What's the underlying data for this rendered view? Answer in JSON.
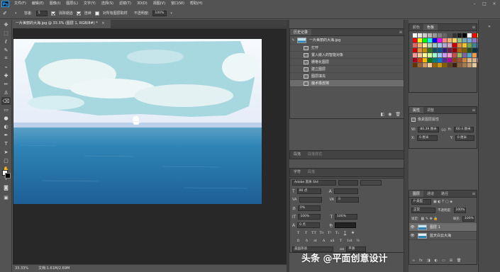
{
  "app": {
    "logo": "Ps"
  },
  "menu": [
    "文件(F)",
    "编辑(E)",
    "图像(I)",
    "图层(L)",
    "文字(Y)",
    "选择(S)",
    "滤镜(T)",
    "3D(D)",
    "视图(V)",
    "窗口(W)",
    "帮助(H)"
  ],
  "options": {
    "size_label": "容差:",
    "size_value": "5",
    "antialias": "消除锯齿",
    "contiguous": "连续",
    "all_layers": "对所有图层取样",
    "opacity_label": "不透明度:",
    "opacity_value": "100%"
  },
  "document": {
    "tab_title": "一片美丽的大海.jpg @ 33.3% (图层 1, RGB/8#) *",
    "close": "×",
    "zoom": "33.33%",
    "docsize": "文档:1.61M/2.69M"
  },
  "history": {
    "tab": "历史记录",
    "snapshot": "一片美丽的大海.jpg",
    "items": [
      "打开",
      "置入嵌入的智能对象",
      "栅格化图层",
      "建立图层",
      "图层填充",
      "魔术橡皮擦"
    ],
    "selected_index": 5
  },
  "swatches": {
    "tab_inactive": "颜色",
    "tab_active": "色板"
  },
  "properties": {
    "tabs": [
      "属性",
      "调整"
    ],
    "title": "像素图层属性",
    "w_label": "W:",
    "w_value": "80.39 厘米",
    "link": "GO",
    "h_label": "H:",
    "h_value": "60.4 厘米",
    "x_label": "X:",
    "x_value": "0 厘米",
    "y_label": "Y:",
    "y_value": "0 厘米"
  },
  "mini_panels": [
    {
      "label": "段落",
      "tab": "段落样式"
    },
    {
      "label": "字符",
      "tab": "段落"
    }
  ],
  "character": {
    "font": "Adobe 黑体 Std",
    "size": "90 点",
    "tracking": "0",
    "scale_v": "100%",
    "scale_h": "100%",
    "baseline": "0 点",
    "percent": "0%",
    "lang": "美国英语",
    "aa": "平滑"
  },
  "layers": {
    "tabs": [
      "图层",
      "通道",
      "路径"
    ],
    "kind": "P 类型",
    "blend": "正常",
    "opacity_label": "不透明度:",
    "opacity_value": "100%",
    "fill_label": "填充:",
    "fill_value": "100%",
    "lock_label": "锁定:",
    "items": [
      "图层 1",
      "蓝天白云大海"
    ]
  },
  "watermark": "头条 @平面创意设计",
  "colors": {
    "panel": "#535353",
    "canvas": "#282828",
    "sky": "#9fd3dc",
    "sea": "#2c79a8",
    "selection": "#6d6d6d"
  },
  "swatch_colors": [
    "#ffffff",
    "#e6e6e6",
    "#cccccc",
    "#b3b3b3",
    "#999999",
    "#808080",
    "#666666",
    "#4d4d4d",
    "#333333",
    "#1a1a1a",
    "#000000",
    "#ffffff",
    "#ff0000",
    "#ffff00",
    "#ff0000",
    "#ffff00",
    "#00ff00",
    "#00ffff",
    "#0000ff",
    "#ff00ff",
    "#f28b82",
    "#f6b26b",
    "#ffd966",
    "#93c47d",
    "#76a5af",
    "#6fa8dc",
    "#8e7cc3",
    "#c27ba0",
    "#e06666",
    "#f6b26b",
    "#ffe599",
    "#b6d7a8",
    "#a2c4c9",
    "#9fc5e8",
    "#b4a7d6",
    "#d5a6bd",
    "#cc0000",
    "#e69138",
    "#f1c232",
    "#6aa84f",
    "#45818e",
    "#3d85c6",
    "#cc0000",
    "#e69138",
    "#bf9000",
    "#38761d",
    "#134f5c",
    "#0b5394",
    "#351c75",
    "#741b47",
    "#990000",
    "#b45f06",
    "#7f6000",
    "#274e13",
    "#0c343d",
    "#073763",
    "#ff9999",
    "#ffcc99",
    "#ffff99",
    "#ccff99",
    "#99ffcc",
    "#99ccff",
    "#cc99ff",
    "#ff99cc",
    "#c0504d",
    "#9bbb59",
    "#8064a2",
    "#4bacc6",
    "#f79646",
    "#1f497d",
    "#a50021",
    "#d83b01",
    "#ffb900",
    "#107c10",
    "#008272",
    "#0078d7",
    "#5c2d91",
    "#b4009e",
    "#8b4513",
    "#a0522d",
    "#cd853f",
    "#deb887",
    "#d2b48c",
    "#bc8f8f",
    "#663300",
    "#996633",
    "#cc9966",
    "#ffcc99",
    "#996600",
    "#cc9900",
    "#806000",
    "#604020",
    "#402010",
    "#8c6239",
    "#a67c52",
    "#c69c6d",
    "#e3c9a1",
    "#754c24"
  ]
}
